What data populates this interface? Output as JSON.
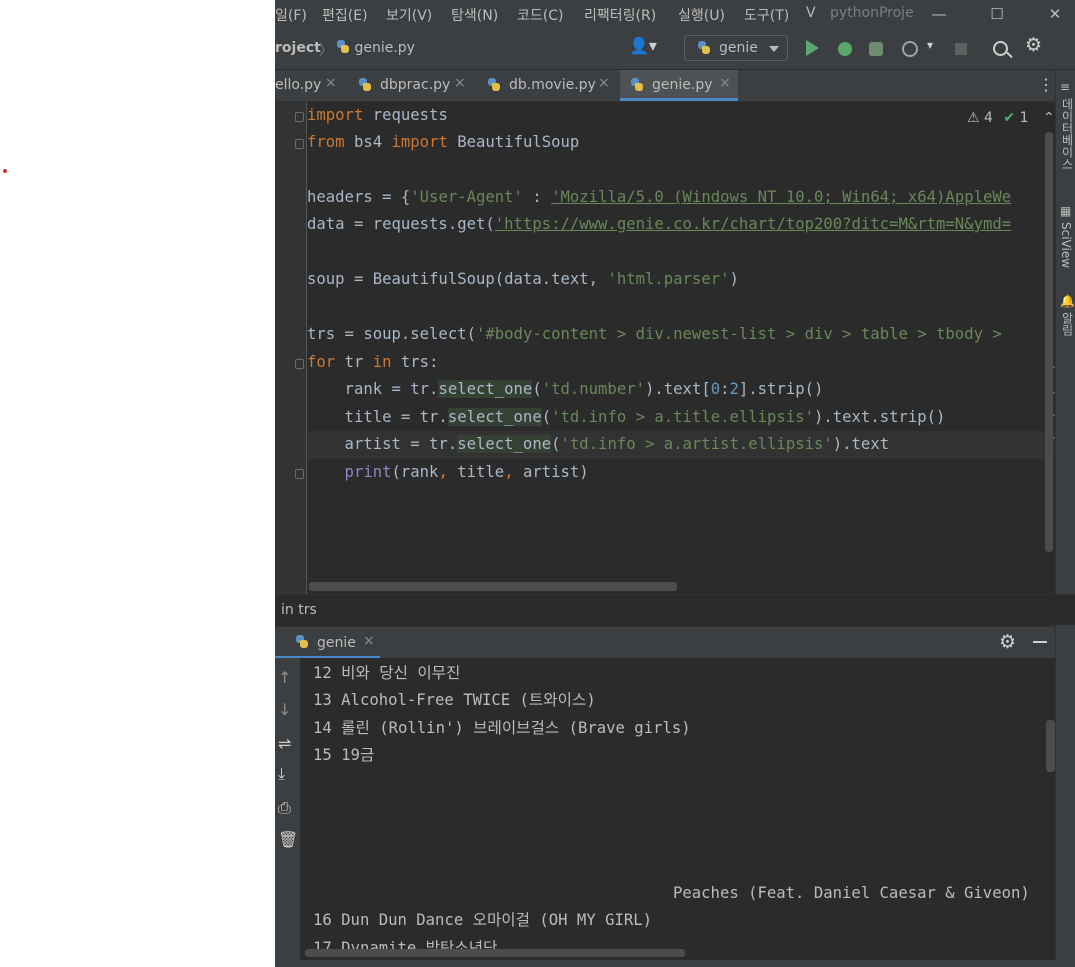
{
  "menu": [
    "일(F)",
    "편집(E)",
    "보기(V)",
    "탐색(N)",
    "코드(C)",
    "리팩터링(R)",
    "실행(U)",
    "도구(T)",
    "V"
  ],
  "project_title": "pythonProje",
  "window_controls": {
    "minimize": "—",
    "maximize": "☐",
    "close": "✕"
  },
  "breadcrumb": {
    "project": "roject",
    "sep": "〉",
    "file": "genie.py"
  },
  "run_config": "genie",
  "tabs": [
    {
      "label": "ello.py",
      "close": "×"
    },
    {
      "label": "dbprac.py",
      "close": "×"
    },
    {
      "label": "db.movie.py",
      "close": "×"
    },
    {
      "label": "genie.py",
      "close": "×",
      "active": true
    }
  ],
  "inspections": {
    "warnings": "4",
    "ok": "1"
  },
  "right_stripe": [
    "데이터베이스",
    "SciView",
    "알림"
  ],
  "code_lines": [
    {
      "k1": "import",
      "t1": " requests"
    },
    {
      "k1": "from",
      "t1": " bs4 ",
      "k2": "import",
      "t2": " BeautifulSoup"
    },
    {
      "t1": "headers = {",
      "s1": "'User-Agent'",
      "t2": " : ",
      "s2": "'Mozilla/5.0 (Windows NT 10.0; Win64; x64)AppleWe"
    },
    {
      "t1": "data = requests.get(",
      "s1": "'https://www.genie.co.kr/chart/top200?ditc=M&rtm=N&ymd="
    },
    {
      "t1": "soup = BeautifulSoup(data.text, ",
      "s1": "'html.parser'",
      "t2": ")"
    },
    {
      "t1": "trs = soup.select(",
      "s1": "'#body-content > div.newest-list > div > table > tbody > "
    },
    {
      "k1": "for",
      "t1": " tr ",
      "k2": "in",
      "t2": " trs:"
    },
    {
      "t1": "    rank = tr.",
      "h1": "select_one",
      "t2": "(",
      "s1": "'td.number'",
      "t3": ").text[",
      "n1": "0",
      "t4": ":",
      "n2": "2",
      "t5": "].strip()"
    },
    {
      "t1": "    title = tr.",
      "h1": "select_one",
      "t2": "(",
      "s1": "'td.info > a.title.ellipsis'",
      "t3": ").text.strip()"
    },
    {
      "t1": "    artist = tr.",
      "h1": "select_one",
      "t2": "(",
      "s1": "'td.info > a.artist.ellipsis'",
      "t3": ").text"
    },
    {
      "b1": "    print",
      "t1": "(rank",
      "c1": ",",
      "t2": " title",
      "c2": ",",
      "t3": " artist)"
    }
  ],
  "status_crumb": "in trs",
  "run_tab": "genie",
  "console_lines": [
    "12 비와 당신 이무진",
    "13 Alcohol-Free TWICE (트와이스)",
    "14 롤린 (Rollin') 브레이브걸스 (Brave girls)",
    "15 19금",
    "Peaches (Feat. Daniel Caesar & Giveon)",
    "16 Dun Dun Dance 오마이걸 (OH MY GIRL)",
    "17 Dynamite 방탄소년단"
  ]
}
